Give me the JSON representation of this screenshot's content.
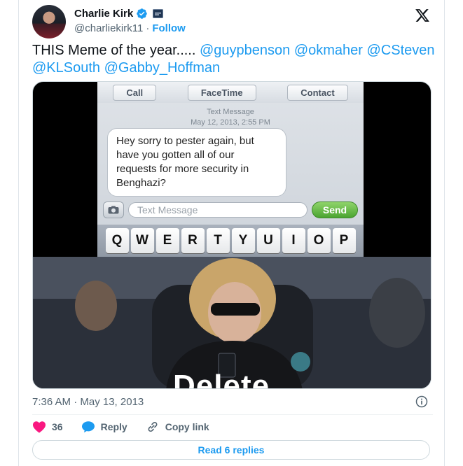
{
  "author": {
    "name": "Charlie Kirk",
    "handle": "@charliekirk11",
    "separator": "·",
    "follow_label": "Follow"
  },
  "tweet": {
    "lead": "THIS  Meme of the year..... ",
    "mentions": [
      "@guypbenson",
      "@okmaher",
      "@CSteven",
      "@KLSouth",
      "@Gabby_Hoffman"
    ]
  },
  "media": {
    "phone_buttons": [
      "Call",
      "FaceTime",
      "Contact"
    ],
    "message_header": "Text Message",
    "message_time": "May 12, 2013, 2:55 PM",
    "message": "Hey sorry to pester again, but have you gotten all of our requests for more security in Benghazi?",
    "compose_placeholder": "Text Message",
    "send_label": "Send",
    "keys": [
      "Q",
      "W",
      "E",
      "R",
      "T",
      "Y",
      "U",
      "I",
      "O",
      "P"
    ],
    "overlay_text": "Delete"
  },
  "meta": {
    "timestamp": "7:36 AM · May 13, 2013"
  },
  "actions": {
    "likes_count": "36",
    "reply_label": "Reply",
    "copy_link_label": "Copy link",
    "read_replies_label": "Read 6 replies"
  },
  "colors": {
    "accent": "#1d9bf0",
    "like": "#f91880",
    "text_secondary": "#536471"
  },
  "icons": [
    "verified-badge-icon",
    "flag-icon",
    "x-logo-icon",
    "info-icon",
    "heart-icon",
    "reply-bubble-icon",
    "link-icon",
    "camera-icon"
  ]
}
